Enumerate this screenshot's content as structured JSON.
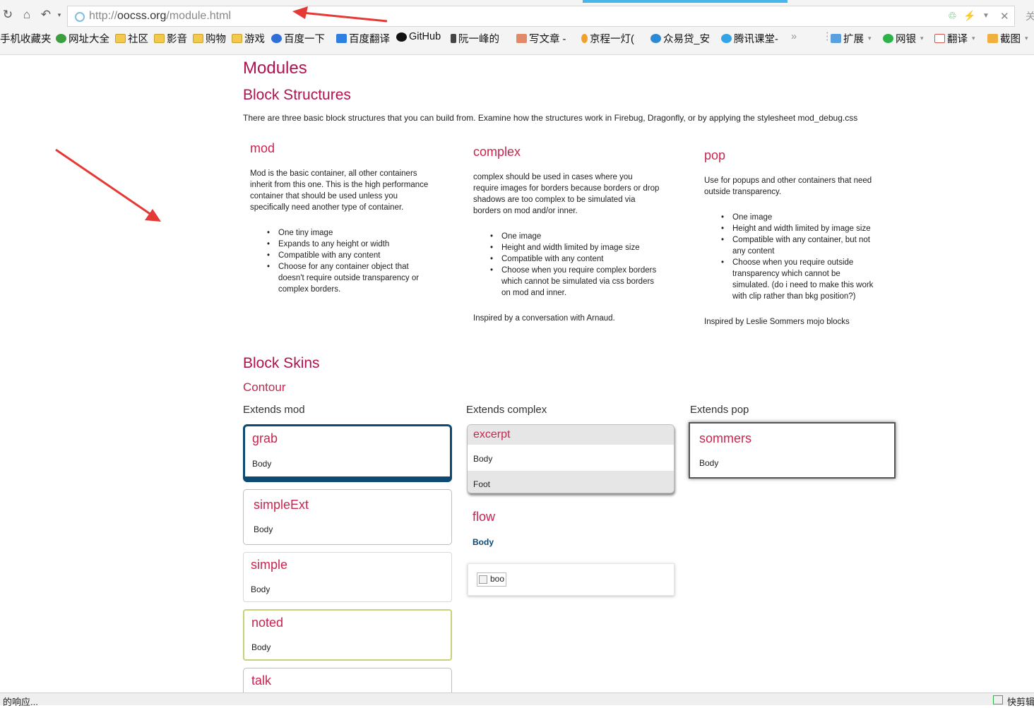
{
  "browser": {
    "url_prefix": "http://",
    "url_domain": "oocss.org",
    "url_path": "/module.html",
    "address_right_glyph": "关",
    "tab_accent_color": "#48b6e8",
    "bookmarks": [
      {
        "label": "手机收藏夹",
        "icon": "none"
      },
      {
        "label": "网址大全",
        "icon": "site-icon"
      },
      {
        "label": "社区",
        "icon": "folder-icon"
      },
      {
        "label": "影音",
        "icon": "folder-icon"
      },
      {
        "label": "购物",
        "icon": "folder-icon"
      },
      {
        "label": "游戏",
        "icon": "folder-icon"
      },
      {
        "label": "百度一下",
        "icon": "baidu-icon"
      },
      {
        "label": "百度翻译",
        "icon": "translate-icon"
      },
      {
        "label": "GitHub",
        "icon": "github-icon"
      },
      {
        "label": "阮一峰的",
        "icon": "blog-icon"
      },
      {
        "label": "写文章 -",
        "icon": "zhihu-icon"
      },
      {
        "label": "京程一灯(",
        "icon": "lamp-icon"
      },
      {
        "label": "众易贷_安",
        "icon": "loan-icon"
      },
      {
        "label": "腾讯课堂-",
        "icon": "tencent-icon"
      }
    ],
    "more_glyph": "»",
    "extensions": [
      {
        "label": "扩展",
        "icon": "grid-icon"
      },
      {
        "label": "网银",
        "icon": "bank-icon"
      },
      {
        "label": "翻译",
        "icon": "translate-icon"
      },
      {
        "label": "截图",
        "icon": "scissors-icon"
      }
    ],
    "status_left": "的响应...",
    "status_right": "快剪辑"
  },
  "page": {
    "title": "Modules",
    "section1": "Block Structures",
    "intro": "There are three basic block structures that you can build from. Examine how the structures work in Firebug, Dragonfly, or by applying the stylesheet mod_debug.css",
    "columns": [
      {
        "title": "mod",
        "desc_lines": [
          "Mod is the basic container, all other containers",
          "inherit from this one. This is the high performance",
          "container that should be used unless you",
          "specifically need another type of container."
        ],
        "bullets": [
          [
            "One tiny image"
          ],
          [
            "Expands to any height or width"
          ],
          [
            "Compatible with any content"
          ],
          [
            "Choose for any container object that",
            "doesn't require outside transparency or",
            "complex borders."
          ]
        ],
        "inspired": ""
      },
      {
        "title": "complex",
        "desc_lines": [
          "complex should be used in cases where you",
          "require images for borders because borders or drop",
          "shadows are too complex to be simulated via",
          "borders on mod and/or inner."
        ],
        "bullets": [
          [
            "One image"
          ],
          [
            "Height and width limited by image size"
          ],
          [
            "Compatible with any content"
          ],
          [
            "Choose when you require complex borders",
            "which cannot be simulated via css borders",
            "on mod and inner."
          ]
        ],
        "inspired": "Inspired by a conversation with Arnaud."
      },
      {
        "title": "pop",
        "desc_lines": [
          "Use for popups and other containers that need",
          "outside transparency."
        ],
        "bullets": [
          [
            "One image"
          ],
          [
            "Height and width limited by image size"
          ],
          [
            "Compatible with any container, but not",
            "any content"
          ],
          [
            "Choose when you require outside",
            "transparency which cannot be",
            "simulated. (do i need to make this work",
            "with clip rather than bkg position?)"
          ]
        ],
        "inspired": "Inspired by Leslie Sommers mojo blocks"
      }
    ],
    "section2": "Block Skins",
    "subsection": "Contour",
    "extends": [
      "Extends mod",
      "Extends complex",
      "Extends pop"
    ],
    "skins_mod": [
      {
        "title": "grab",
        "body": "Body"
      },
      {
        "title": "simpleExt",
        "body": "Body"
      },
      {
        "title": "simple",
        "body": "Body"
      },
      {
        "title": "noted",
        "body": "Body"
      },
      {
        "title": "talk",
        "body": ""
      }
    ],
    "skin_excerpt": {
      "title": "excerpt",
      "body": "Body",
      "foot": "Foot"
    },
    "skin_flow": {
      "title": "flow",
      "body": "Body",
      "img_alt": "boo"
    },
    "skin_pop": {
      "title": "sommers",
      "body": "Body"
    },
    "colors": {
      "heading": "#b0124f",
      "accent": "#c7254e",
      "grab_border": "#0d4a73",
      "noted_border": "#c8d07a",
      "arrow": "#e53935"
    }
  }
}
